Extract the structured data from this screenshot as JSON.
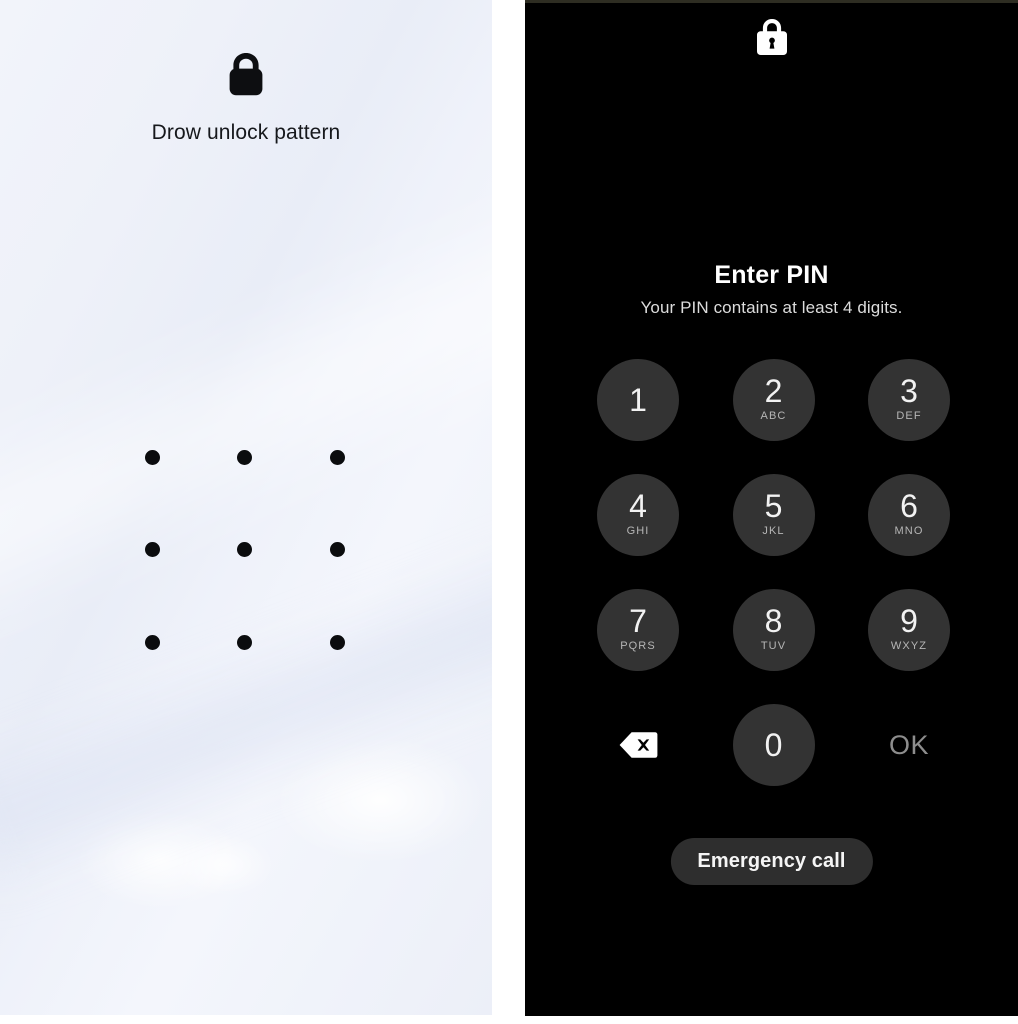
{
  "pattern_screen": {
    "lock_icon": "lock-icon",
    "title": "Drow unlock pattern",
    "grid": {
      "rows": 3,
      "cols": 3,
      "dots": [
        {
          "row": 1,
          "col": 1
        },
        {
          "row": 1,
          "col": 2
        },
        {
          "row": 1,
          "col": 3
        },
        {
          "row": 2,
          "col": 1
        },
        {
          "row": 2,
          "col": 2
        },
        {
          "row": 2,
          "col": 3
        },
        {
          "row": 3,
          "col": 1
        },
        {
          "row": 3,
          "col": 2
        },
        {
          "row": 3,
          "col": 3
        }
      ],
      "dot_color": "#0b0c0e"
    },
    "background_color": "#eef1f9",
    "text_color": "#16181c"
  },
  "pin_screen": {
    "lock_icon": "lock-icon",
    "title": "Enter PIN",
    "subtitle": "Your PIN contains at least 4 digits.",
    "background_color": "#000000",
    "key_color": "#333333",
    "digit_color": "#f2f2f2",
    "letters_color": "#b6b6b6",
    "keypad": [
      [
        {
          "digit": "1",
          "letters": ""
        },
        {
          "digit": "2",
          "letters": "ABC"
        },
        {
          "digit": "3",
          "letters": "DEF"
        }
      ],
      [
        {
          "digit": "4",
          "letters": "GHI"
        },
        {
          "digit": "5",
          "letters": "JKL"
        },
        {
          "digit": "6",
          "letters": "MNO"
        }
      ],
      [
        {
          "digit": "7",
          "letters": "PQRS"
        },
        {
          "digit": "8",
          "letters": "TUV"
        },
        {
          "digit": "9",
          "letters": "WXYZ"
        }
      ]
    ],
    "bottom_row": {
      "backspace_icon": "backspace-icon",
      "zero": {
        "digit": "0",
        "letters": ""
      },
      "ok_label": "OK",
      "ok_color": "#8d8d8d"
    },
    "emergency_call_label": "Emergency call",
    "emergency_call_bg": "#2e2e2e"
  }
}
